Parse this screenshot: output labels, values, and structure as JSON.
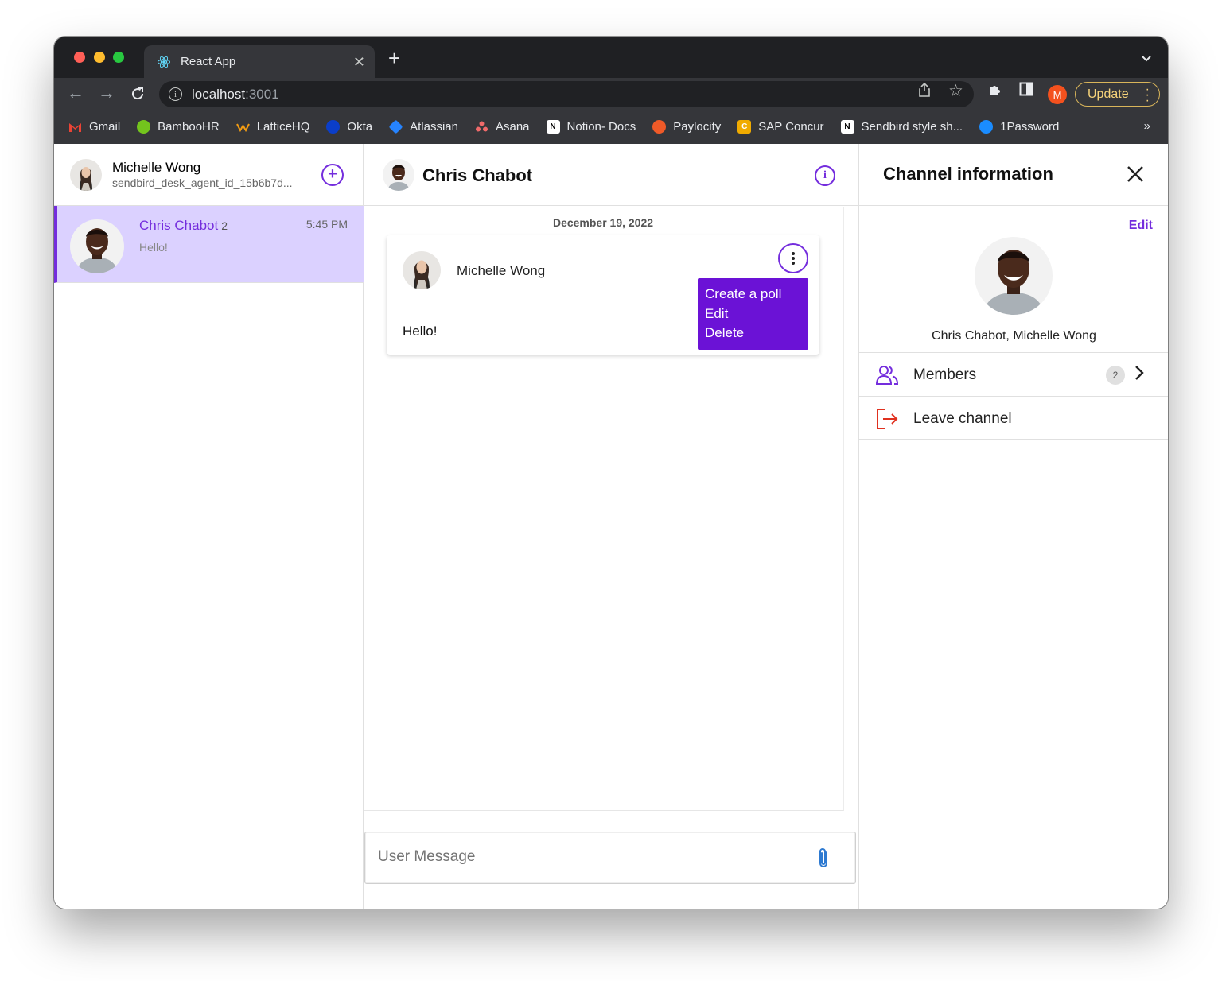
{
  "browser": {
    "tab_title": "React App",
    "url_host": "localhost",
    "url_port": ":3001",
    "profile_initial": "M",
    "update_label": "Update",
    "bookmarks": [
      {
        "label": "Gmail",
        "icon": "gmail-icon",
        "color": "#ea4335"
      },
      {
        "label": "BambooHR",
        "icon": "bamboohr-icon",
        "color": "#73c41d"
      },
      {
        "label": "LatticeHQ",
        "icon": "lattice-icon",
        "color": "#f39c12"
      },
      {
        "label": "Okta",
        "icon": "okta-icon",
        "color": "#0b3ec9"
      },
      {
        "label": "Atlassian",
        "icon": "atlassian-icon",
        "color": "#2684ff"
      },
      {
        "label": "Asana",
        "icon": "asana-icon",
        "color": "#f06a6a"
      },
      {
        "label": "Notion- Docs",
        "icon": "notion-icon",
        "color": "#ffffff"
      },
      {
        "label": "Paylocity",
        "icon": "paylocity-icon",
        "color": "#f05a28"
      },
      {
        "label": "SAP Concur",
        "icon": "sap-concur-icon",
        "color": "#f0ab00"
      },
      {
        "label": "Sendbird style sh...",
        "icon": "notion-icon",
        "color": "#ffffff"
      },
      {
        "label": "1Password",
        "icon": "1password-icon",
        "color": "#1a8cff"
      }
    ],
    "bookmarks_more": "»"
  },
  "sidebar": {
    "user_name": "Michelle Wong",
    "user_id": "sendbird_desk_agent_id_15b6b7d...",
    "channels": [
      {
        "name": "Chris Chabot",
        "member_count": "2",
        "time": "5:45 PM",
        "last_message": "Hello!"
      }
    ]
  },
  "conversation": {
    "title": "Chris Chabot",
    "date_separator": "December 19, 2022",
    "messages": [
      {
        "sender": "Michelle Wong",
        "text": "Hello!"
      }
    ],
    "message_menu": [
      "Create a poll",
      "Edit",
      "Delete"
    ],
    "composer_placeholder": "User Message"
  },
  "channel_info": {
    "title": "Channel information",
    "edit_label": "Edit",
    "group_name": "Chris Chabot, Michelle Wong",
    "members_label": "Members",
    "members_count": "2",
    "leave_label": "Leave channel"
  },
  "colors": {
    "accent": "#742ddd",
    "selected_channel_bg": "#dbd1ff",
    "menu_bg": "#6b12d6",
    "leave_icon": "#e0311f"
  }
}
